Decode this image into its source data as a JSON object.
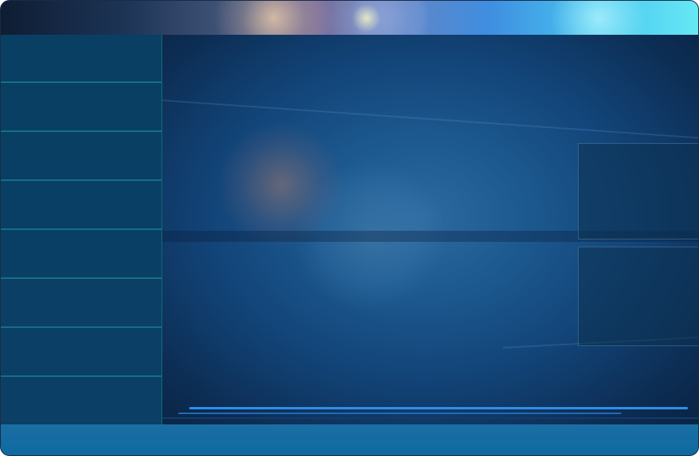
{
  "window": {
    "title": ""
  },
  "sidebar": {
    "items": [
      {
        "label": ""
      },
      {
        "label": ""
      },
      {
        "label": ""
      },
      {
        "label": ""
      },
      {
        "label": ""
      },
      {
        "label": ""
      },
      {
        "label": ""
      },
      {
        "label": ""
      }
    ]
  },
  "statusbar": {
    "text": ""
  },
  "colors": {
    "titlebar_start": "#0f1d33",
    "titlebar_end": "#66e8f4",
    "sidebar_bg": "#0a3f64",
    "separator": "#16707f",
    "main_bg": "#124478",
    "statusbar_bg": "#0f6aa0",
    "accent_stripe": "#2f8fe8"
  }
}
